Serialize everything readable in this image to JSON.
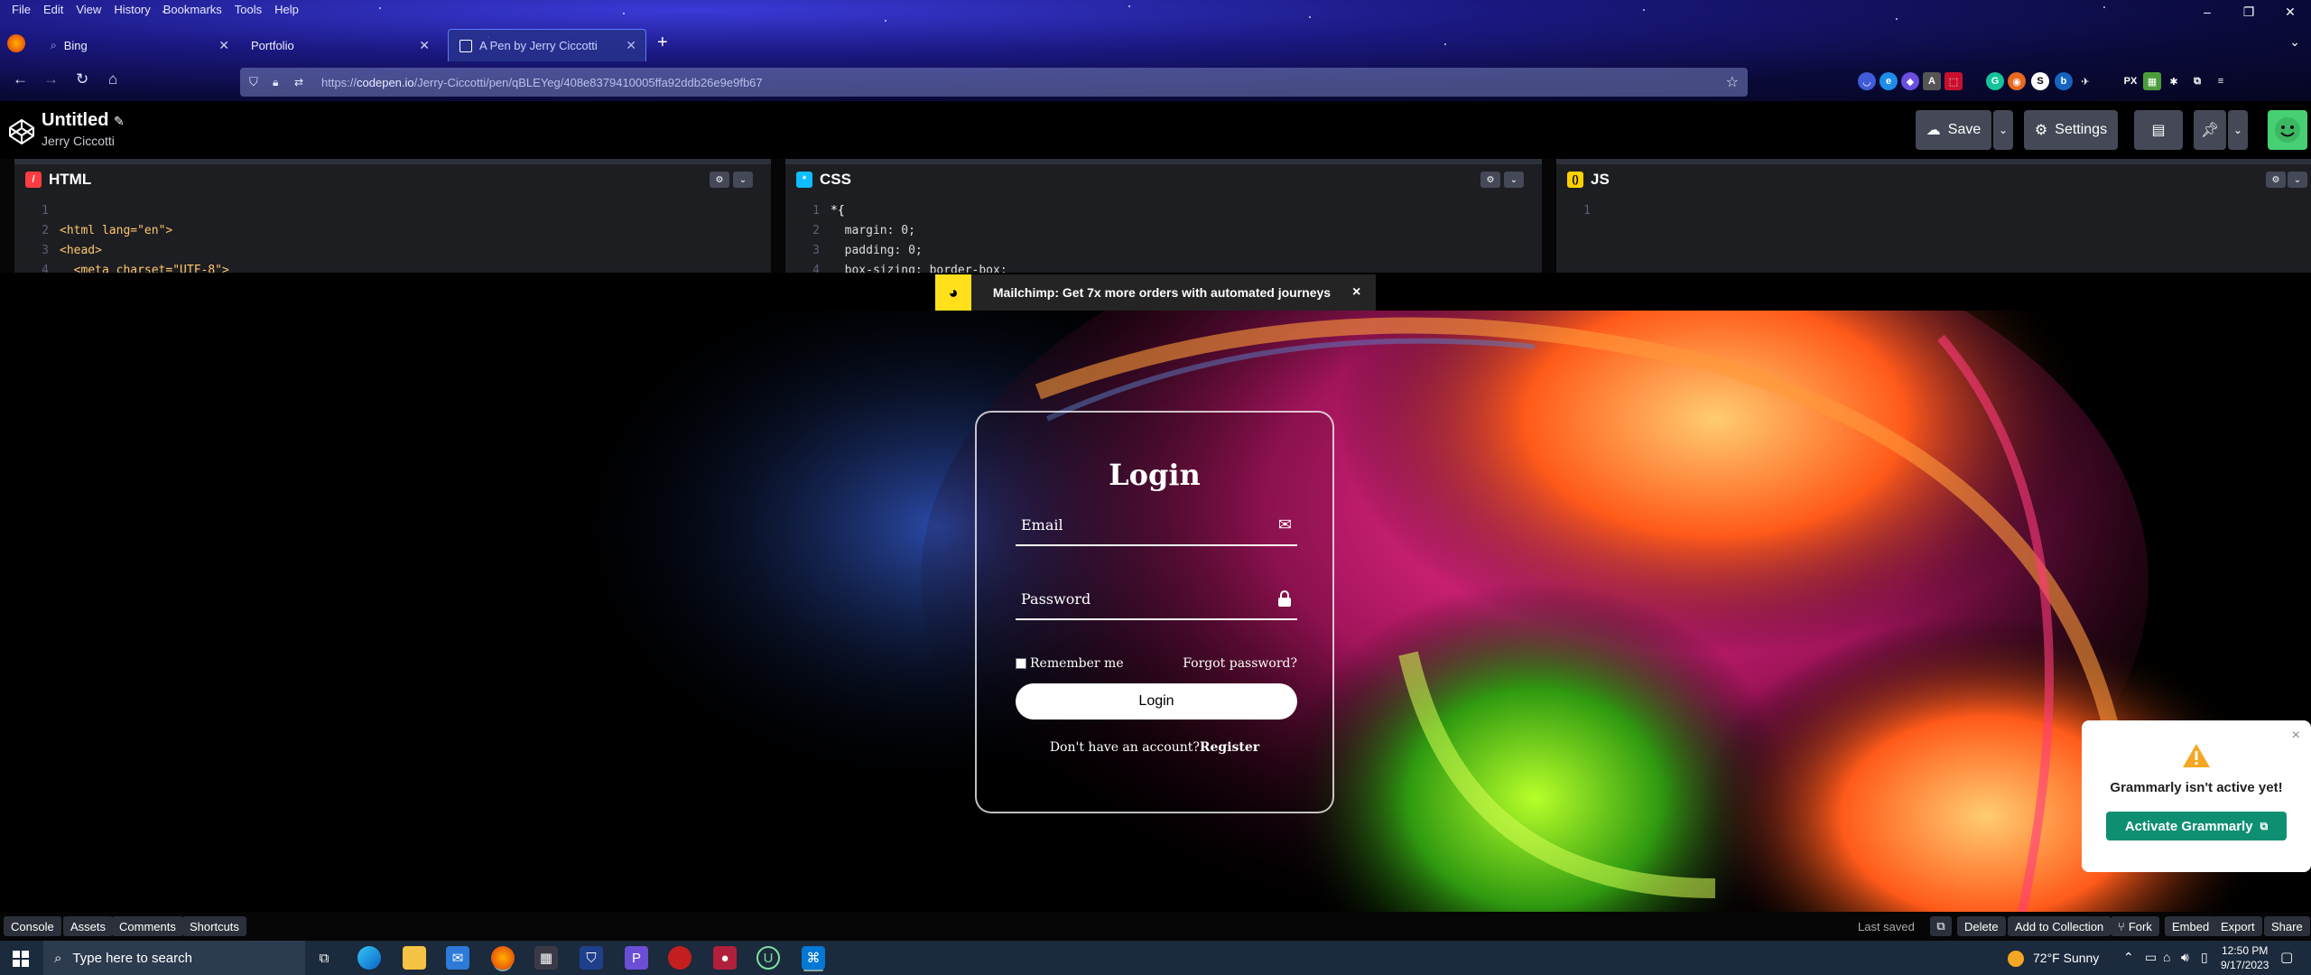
{
  "menubar": [
    "File",
    "Edit",
    "View",
    "History",
    "Bookmarks",
    "Tools",
    "Help"
  ],
  "tabs": [
    {
      "label": "Bing",
      "active": false
    },
    {
      "label": "Portfolio",
      "active": false
    },
    {
      "label": "A Pen by Jerry Ciccotti",
      "active": true
    }
  ],
  "url": {
    "prefix": "https://",
    "domain": "codepen.io",
    "path": "/Jerry-Ciccotti/pen/qBLEYeg/408e8379410005ffa92ddb26e9e9fb67"
  },
  "pen": {
    "title": "Untitled",
    "author": "Jerry Ciccotti"
  },
  "header_buttons": {
    "save": "Save",
    "settings": "Settings"
  },
  "editors": {
    "html": {
      "label": "HTML",
      "lines": [
        {
          "n": "1",
          "code": ""
        },
        {
          "n": "2",
          "code": "<html lang=\"en\">"
        },
        {
          "n": "3",
          "code": "<head>"
        },
        {
          "n": "4",
          "code": "  <meta charset=\"UTF-8\">"
        }
      ]
    },
    "css": {
      "label": "CSS",
      "lines": [
        {
          "n": "1",
          "code": "*{"
        },
        {
          "n": "2",
          "code": "  margin: 0;"
        },
        {
          "n": "3",
          "code": "  padding: 0;"
        },
        {
          "n": "4",
          "code": "  box-sizing: border-box;"
        }
      ]
    },
    "js": {
      "label": "JS",
      "lines": [
        {
          "n": "1",
          "code": ""
        }
      ]
    }
  },
  "ad": {
    "text": "Mailchimp: Get 7x more orders with automated journeys",
    "close": "×"
  },
  "login": {
    "title": "Login",
    "email_label": "Email",
    "password_label": "Password",
    "remember": "Remember me",
    "forgot": "Forgot password?",
    "button": "Login",
    "no_account": "Don't have an account?",
    "register": "Register"
  },
  "grammarly": {
    "message": "Grammarly isn't active yet!",
    "button": "Activate Grammarly",
    "close": "×"
  },
  "footer": {
    "left": [
      "Console",
      "Assets",
      "Comments",
      "Shortcuts"
    ],
    "last_saved": "Last saved",
    "right": [
      "Delete",
      "Add to Collection",
      "Fork",
      "Embed",
      "Export",
      "Share"
    ]
  },
  "taskbar": {
    "search_placeholder": "Type here to search",
    "weather": "72°F  Sunny",
    "time": "12:50 PM",
    "date": "9/17/2023"
  },
  "colors": {
    "codepen_green": "#47cf73",
    "grammarly_green": "#0f8f72",
    "tab_accent": "#5a7aff",
    "mailchimp_yellow": "#ffe01b"
  }
}
